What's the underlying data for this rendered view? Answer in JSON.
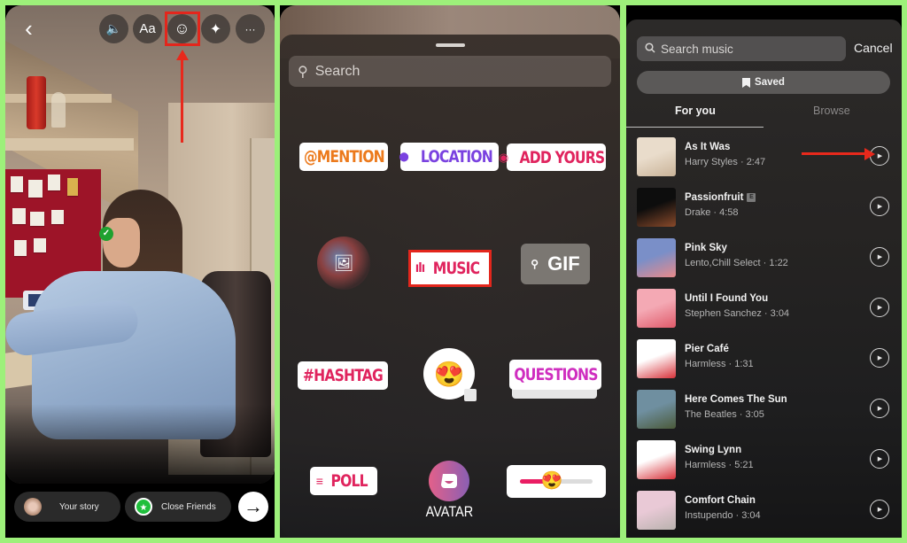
{
  "panel_story": {
    "top_toolbar": [
      {
        "name": "back",
        "glyph": "‹"
      },
      {
        "name": "sound",
        "glyph": "🔈"
      },
      {
        "name": "text",
        "glyph": "Aa"
      },
      {
        "name": "sticker",
        "glyph": "☺"
      },
      {
        "name": "effects",
        "glyph": "✦"
      },
      {
        "name": "more",
        "glyph": "···"
      }
    ],
    "your_story_label": "Your story",
    "close_friends_label": "Close Friends",
    "close_friends_star": "★",
    "next_glyph": "→",
    "photo_check": "✓",
    "highlight_color": "#e3261c"
  },
  "panel_stickers": {
    "search_placeholder": "Search",
    "search_icon": "⚲",
    "stickers": {
      "mention": {
        "label": "@MENTION",
        "color": "#ec7a1c"
      },
      "location": {
        "label": "LOCATION",
        "icon": "⬤",
        "color": "#7a42e0"
      },
      "add_yours": {
        "label": "ADD YOURS",
        "icon": "◉",
        "color": "#e0245e"
      },
      "music": {
        "label": "MUSIC",
        "icon": "ıIı",
        "color": "#e0245e"
      },
      "gif": {
        "label": "GIF",
        "icon": "⚲"
      },
      "hashtag": {
        "label": "#HASHTAG",
        "color": "#e0245e"
      },
      "emoji": {
        "glyph": "😍"
      },
      "questions": {
        "label": "QUESTIONS",
        "color": "#cf2ebf"
      },
      "poll": {
        "label": "POLL",
        "icon": "≡",
        "color": "#e0245e"
      },
      "avatar": {
        "label": "AVATAR"
      },
      "slider": {
        "value": 0.42,
        "knob": "😍"
      }
    },
    "photo_icon": "🖼"
  },
  "panel_music": {
    "search_placeholder": "Search music",
    "cancel_label": "Cancel",
    "saved_label": "Saved",
    "tabs": [
      {
        "label": "For you",
        "active": true
      },
      {
        "label": "Browse",
        "active": false
      }
    ],
    "tracks": [
      {
        "title": "As It Was",
        "artist": "Harry Styles",
        "duration": "2:47",
        "explicit": false,
        "art": [
          "#e9dccb",
          "#c9b398"
        ]
      },
      {
        "title": "Passionfruit",
        "artist": "Drake",
        "duration": "4:58",
        "explicit": true,
        "art": [
          "#0d0d0d",
          "#8a4a2a"
        ]
      },
      {
        "title": "Pink Sky",
        "artist": "Lento,Chill Select",
        "duration": "1:22",
        "explicit": false,
        "art": [
          "#7a8fc8",
          "#e98a8a"
        ]
      },
      {
        "title": "Until I Found You",
        "artist": "Stephen Sanchez",
        "duration": "3:04",
        "explicit": false,
        "art": [
          "#f4a9b4",
          "#e05a6a"
        ]
      },
      {
        "title": "Pier Café",
        "artist": "Harmless",
        "duration": "1:31",
        "explicit": false,
        "art": [
          "#ffffff",
          "#d8323a"
        ]
      },
      {
        "title": "Here Comes The Sun",
        "artist": "The Beatles",
        "duration": "3:05",
        "explicit": false,
        "art": [
          "#6f8fa0",
          "#4b5a3a"
        ]
      },
      {
        "title": "Swing Lynn",
        "artist": "Harmless",
        "duration": "5:21",
        "explicit": false,
        "art": [
          "#ffffff",
          "#d8323a"
        ]
      },
      {
        "title": "Comfort Chain",
        "artist": "Instupendo",
        "duration": "3:04",
        "explicit": false,
        "art": [
          "#e9c9d6",
          "#b9b2ae"
        ]
      }
    ],
    "explicit_badge": "E",
    "play_glyph": "▶",
    "bookmark_glyph": "🔖"
  },
  "annotation_color": "#e8291c"
}
